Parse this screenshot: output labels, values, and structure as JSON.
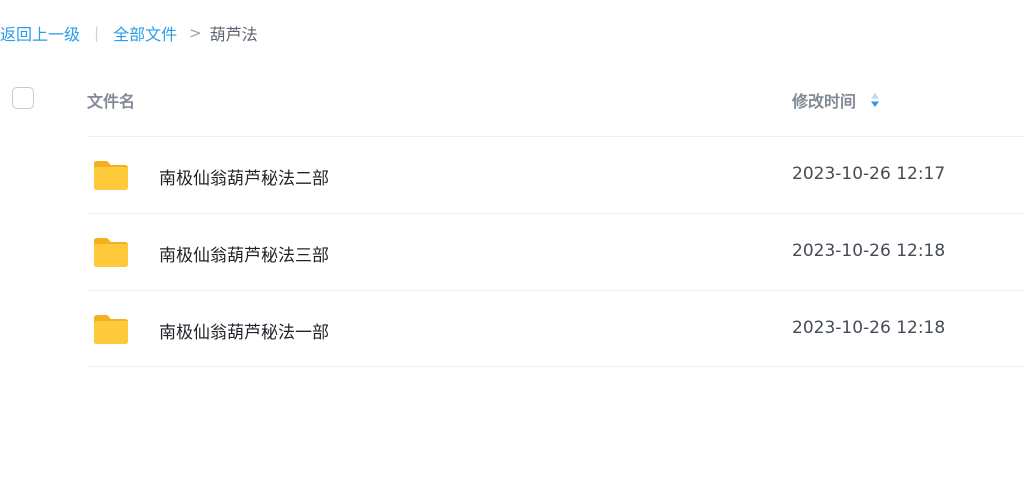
{
  "breadcrumb": {
    "back": "返回上一级",
    "separator": "|",
    "all_files": "全部文件",
    "arrow": ">",
    "current": "葫芦法"
  },
  "table": {
    "headers": {
      "name": "文件名",
      "modified": "修改时间"
    },
    "rows": [
      {
        "icon": "folder-icon",
        "name": "南极仙翁葫芦秘法二部",
        "modified": "2023-10-26 12:17"
      },
      {
        "icon": "folder-icon",
        "name": "南极仙翁葫芦秘法三部",
        "modified": "2023-10-26 12:18"
      },
      {
        "icon": "folder-icon",
        "name": "南极仙翁葫芦秘法一部",
        "modified": "2023-10-26 12:18"
      }
    ]
  },
  "colors": {
    "link": "#2a9ee8",
    "folder": "#ffc93c",
    "sort_active": "#2a9ee8",
    "sort_inactive": "#b8dcf5"
  }
}
